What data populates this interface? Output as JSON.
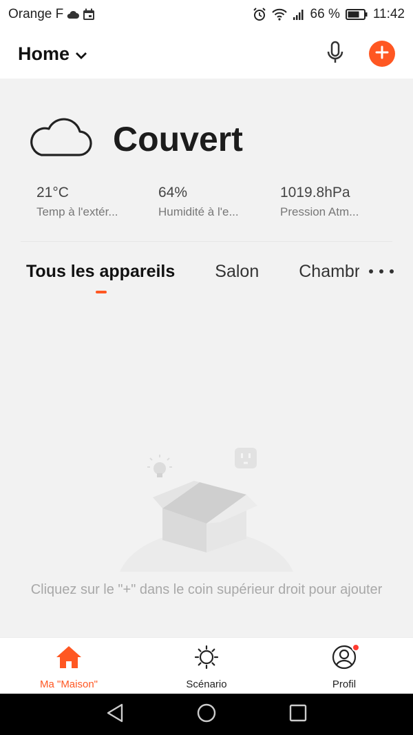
{
  "status_bar": {
    "carrier": "Orange F",
    "battery": "66 %",
    "time": "11:42",
    "icons": [
      "cloud-icon",
      "calendar-icon",
      "alarm-icon",
      "wifi-icon",
      "signal-icon",
      "battery-icon"
    ]
  },
  "header": {
    "title": "Home",
    "icons": [
      "chevron-down-icon",
      "microphone-icon",
      "plus-icon"
    ]
  },
  "weather": {
    "condition": "Couvert",
    "icon": "cloud-icon",
    "stats": [
      {
        "value": "21°C",
        "label": "Temp à l'extér..."
      },
      {
        "value": "64%",
        "label": "Humidité à l'e..."
      },
      {
        "value": "1019.8hPa",
        "label": "Pression Atm..."
      }
    ]
  },
  "tabs": [
    {
      "label": "Tous les appareils",
      "active": true
    },
    {
      "label": "Salon",
      "active": false
    },
    {
      "label": "Chambre",
      "active": false
    }
  ],
  "empty_state": {
    "message": "Cliquez sur le \"+\" dans le coin supérieur droit pour ajouter"
  },
  "bottom_nav": [
    {
      "label": "Ma \"Maison\"",
      "icon": "home-icon",
      "active": true
    },
    {
      "label": "Scénario",
      "icon": "sun-icon",
      "active": false
    },
    {
      "label": "Profil",
      "icon": "profile-icon",
      "active": false
    }
  ],
  "colors": {
    "accent": "#ff5722",
    "background": "#f2f2f2",
    "notification": "#ff3b30"
  }
}
